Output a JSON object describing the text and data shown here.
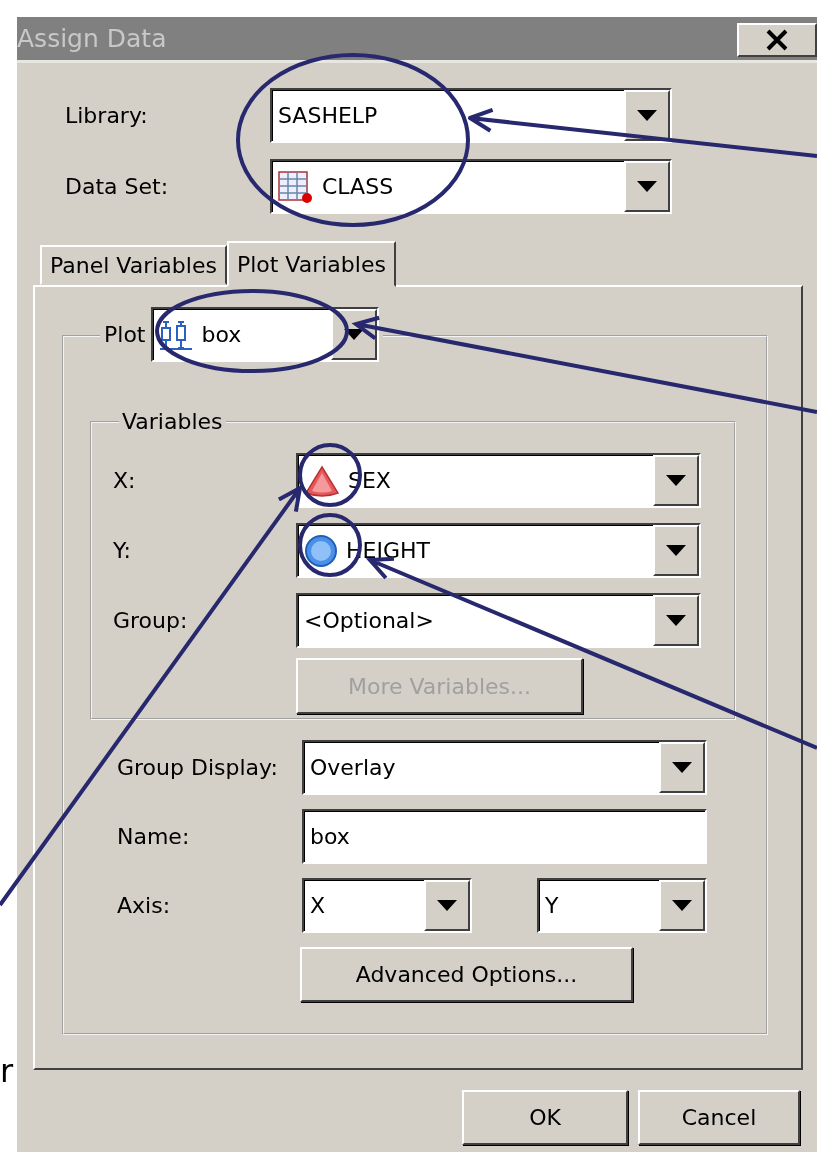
{
  "window": {
    "title": "Assign Data"
  },
  "library": {
    "label": "Library:",
    "value": "SASHELP"
  },
  "data_set": {
    "label": "Data Set:",
    "value": "CLASS"
  },
  "tabs": [
    {
      "label": "Panel Variables",
      "selected": false
    },
    {
      "label": "Plot Variables",
      "selected": true
    }
  ],
  "plot": {
    "label": "Plot",
    "value": "box"
  },
  "variables": {
    "title": "Variables",
    "rows": [
      {
        "label": "X:",
        "value": "SEX",
        "kind": "character"
      },
      {
        "label": "Y:",
        "value": "HEIGHT",
        "kind": "numeric"
      },
      {
        "label": "Group:",
        "value": "<Optional>",
        "kind": "none"
      }
    ]
  },
  "more_variables": {
    "label": "More Variables...",
    "disabled": true
  },
  "group_display": {
    "label": "Group Display:",
    "value": "Overlay"
  },
  "name": {
    "label": "Name:",
    "value": "box"
  },
  "axis": {
    "label": "Axis:",
    "x_value": "X",
    "y_value": "Y"
  },
  "advanced_button": "Advanced Options...",
  "buttons": [
    "OK",
    "Cancel"
  ],
  "annotation_text": "r"
}
